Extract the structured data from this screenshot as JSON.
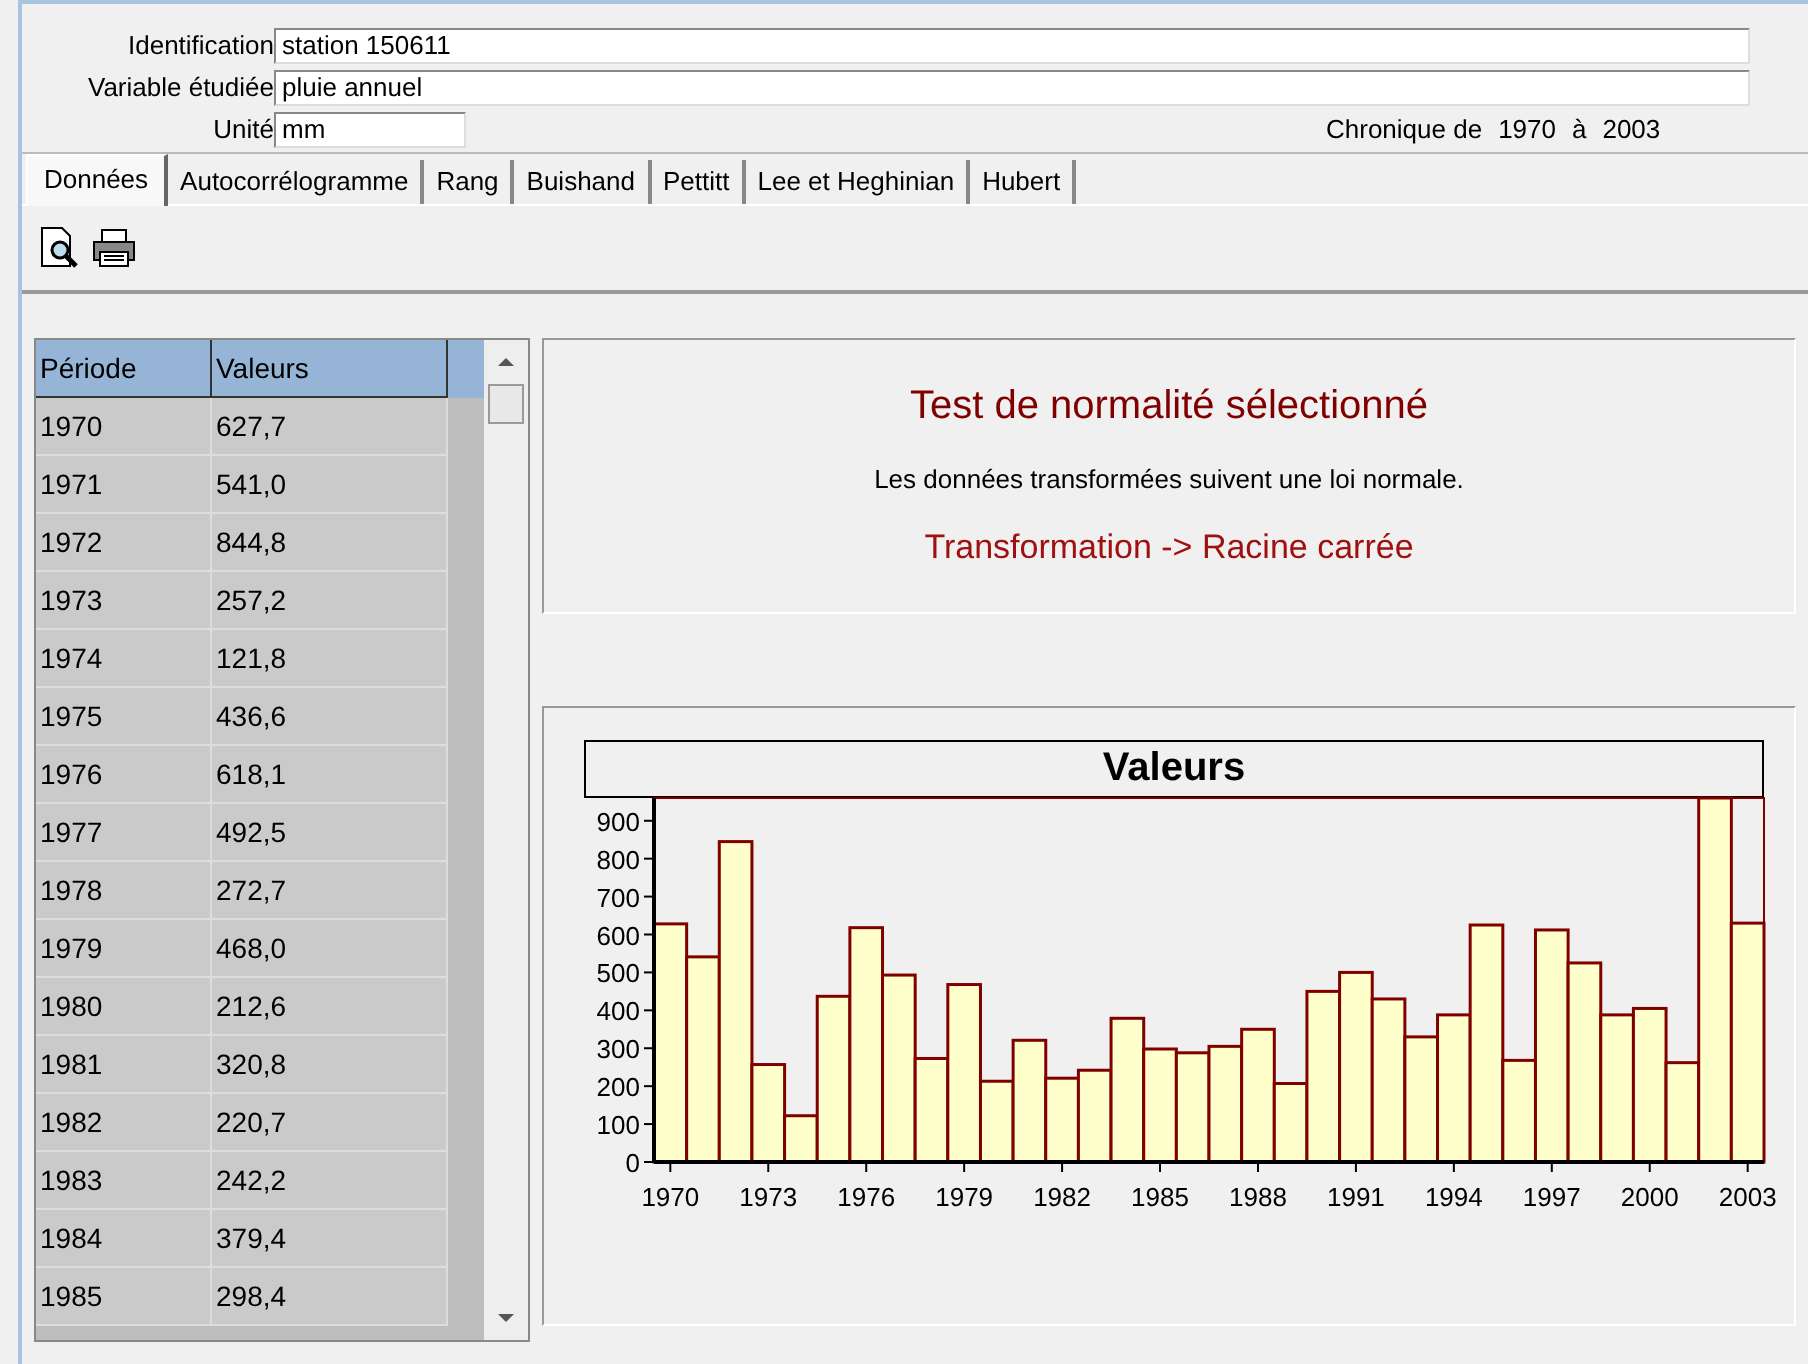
{
  "header": {
    "fields": [
      {
        "label": "Identification",
        "value": "station 150611",
        "kind": "wide"
      },
      {
        "label": "Variable étudiée",
        "value": "pluie annuel",
        "kind": "wide"
      },
      {
        "label": "Unité",
        "value": "mm",
        "kind": "short"
      }
    ],
    "period": {
      "prefix": "Chronique de",
      "start": "1970",
      "middle": "à",
      "end": "2003"
    }
  },
  "tabs": [
    {
      "label": "Données",
      "selected": true
    },
    {
      "label": "Autocorrélogramme",
      "selected": false
    },
    {
      "label": "Rang",
      "selected": false
    },
    {
      "label": "Buishand",
      "selected": false
    },
    {
      "label": "Pettitt",
      "selected": false
    },
    {
      "label": "Lee et Heghinian",
      "selected": false
    },
    {
      "label": "Hubert",
      "selected": false
    }
  ],
  "table": {
    "columns": [
      "Période",
      "Valeurs"
    ],
    "rows": [
      [
        "1970",
        "627,7"
      ],
      [
        "1971",
        "541,0"
      ],
      [
        "1972",
        "844,8"
      ],
      [
        "1973",
        "257,2"
      ],
      [
        "1974",
        "121,8"
      ],
      [
        "1975",
        "436,6"
      ],
      [
        "1976",
        "618,1"
      ],
      [
        "1977",
        "492,5"
      ],
      [
        "1978",
        "272,7"
      ],
      [
        "1979",
        "468,0"
      ],
      [
        "1980",
        "212,6"
      ],
      [
        "1981",
        "320,8"
      ],
      [
        "1982",
        "220,7"
      ],
      [
        "1983",
        "242,2"
      ],
      [
        "1984",
        "379,4"
      ],
      [
        "1985",
        "298,4"
      ]
    ]
  },
  "normality": {
    "title": "Test de normalité sélectionné",
    "message": "Les données transformées suivent une loi normale.",
    "transformation": "Transformation -> Racine carrée"
  },
  "chart": {
    "chart_data": {
      "type": "bar",
      "title": "Valeurs",
      "x": [
        1970,
        1971,
        1972,
        1973,
        1974,
        1975,
        1976,
        1977,
        1978,
        1979,
        1980,
        1981,
        1982,
        1983,
        1984,
        1985,
        1986,
        1987,
        1988,
        1989,
        1990,
        1991,
        1992,
        1993,
        1994,
        1995,
        1996,
        1997,
        1998,
        1999,
        2000,
        2001,
        2002,
        2003
      ],
      "series": [
        {
          "color": "#ffffcc",
          "values": [
            628,
            541,
            845,
            257,
            122,
            437,
            618,
            493,
            273,
            468,
            213,
            321,
            221,
            242,
            379,
            298,
            288,
            305,
            350,
            207,
            450,
            500,
            430,
            330,
            388,
            625,
            268,
            612,
            525,
            388,
            405,
            262,
            960,
            630
          ]
        }
      ],
      "xlim": [
        1969.5,
        2003.5
      ],
      "ylim": [
        0,
        960
      ],
      "yticks": [
        0,
        100,
        200,
        300,
        400,
        500,
        600,
        700,
        800,
        900
      ],
      "xticks": [
        1970,
        1973,
        1976,
        1979,
        1982,
        1985,
        1988,
        1991,
        1994,
        1997,
        2000,
        2003
      ]
    }
  }
}
